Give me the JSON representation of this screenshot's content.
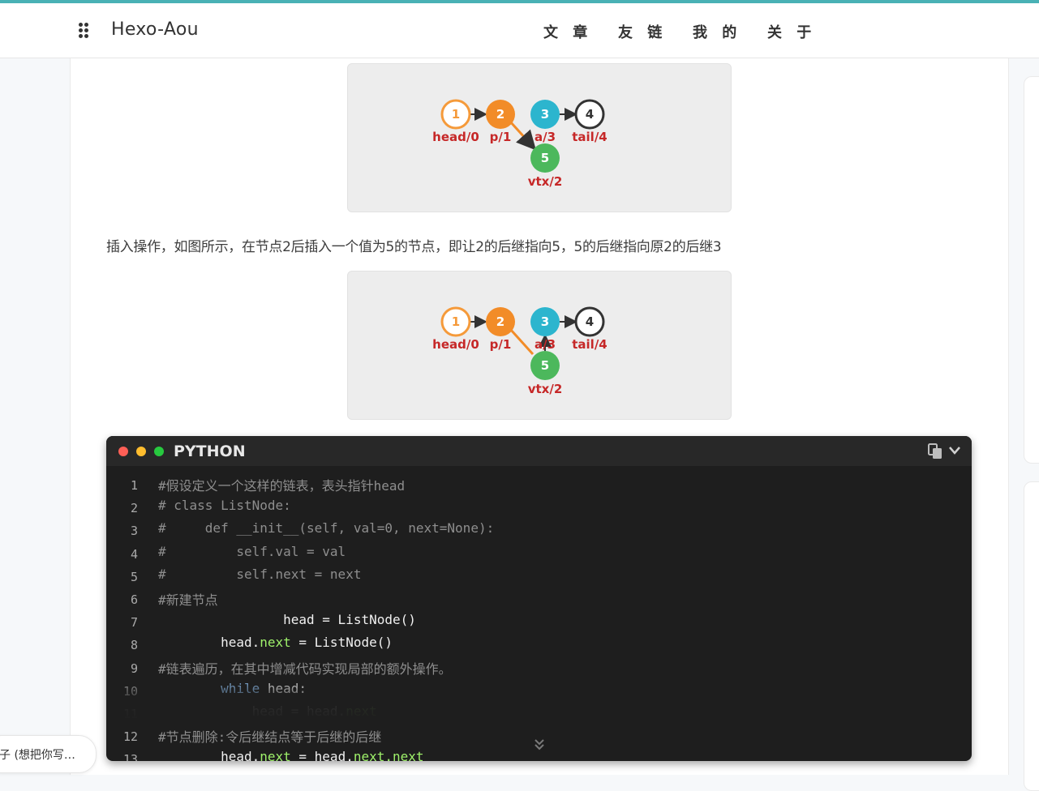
{
  "header": {
    "site_title": "Hexo-Aou",
    "nav": [
      "文 章",
      "友 链",
      "我 的",
      "关 于"
    ]
  },
  "figure": {
    "nodes": [
      {
        "num": "1",
        "label": "head/0",
        "color": "#f59a3a"
      },
      {
        "num": "2",
        "label": "p/1",
        "color": "#f28c28"
      },
      {
        "num": "3",
        "label": "a/3",
        "color": "#2cb5ce"
      },
      {
        "num": "4",
        "label": "tail/4",
        "color": "#333333"
      },
      {
        "num": "5",
        "label": "vtx/2",
        "color": "#4cb85c"
      }
    ]
  },
  "content": {
    "paragraph": "插入操作，如图所示，在节点2后插入一个值为5的节点，即让2的后继指向5，5的后继指向原2的后继3"
  },
  "code_block": {
    "language": "PYTHON",
    "icons": [
      "copy-icon",
      "chevron-down-icon",
      "expand-icon"
    ],
    "lines": [
      {
        "n": "1",
        "indent": "",
        "text": "#假设定义一个这样的链表，表头指针head"
      },
      {
        "n": "2",
        "indent": "",
        "text": "# class ListNode:"
      },
      {
        "n": "3",
        "indent": "",
        "text": "#     def __init__(self, val=0, next=None):"
      },
      {
        "n": "4",
        "indent": "",
        "text": "#         self.val = val"
      },
      {
        "n": "5",
        "indent": "",
        "text": "#         self.next = next"
      },
      {
        "n": "6",
        "indent": "",
        "text": "#新建节点"
      },
      {
        "n": "7",
        "indent": "                ",
        "a": "head = ListNode()"
      },
      {
        "n": "8",
        "indent": "        ",
        "a": "head.",
        "b": "next",
        "c": " = ListNode()"
      },
      {
        "n": "9",
        "indent": "",
        "text": "#链表遍历，在其中增减代码实现局部的额外操作。"
      },
      {
        "n": "10",
        "indent": "        ",
        "kw": "while",
        "a": " head:"
      },
      {
        "n": "11",
        "indent": "            ",
        "a": "head = head.",
        "b": "next"
      },
      {
        "n": "12",
        "indent": "",
        "text": "#节点删除:令后继结点等于后继的后继"
      },
      {
        "n": "13",
        "indent": "        ",
        "a": "head.",
        "b": "next",
        "c": " = head.",
        "d": "next.next"
      }
    ]
  },
  "chat": {
    "text": "子 (想把你写…"
  },
  "colors": {
    "accent": "#49b1b5",
    "code_bg": "#1e1e1e",
    "dot_red": "#ff5f56",
    "dot_yellow": "#ffbd2e",
    "dot_green": "#27c93f"
  }
}
